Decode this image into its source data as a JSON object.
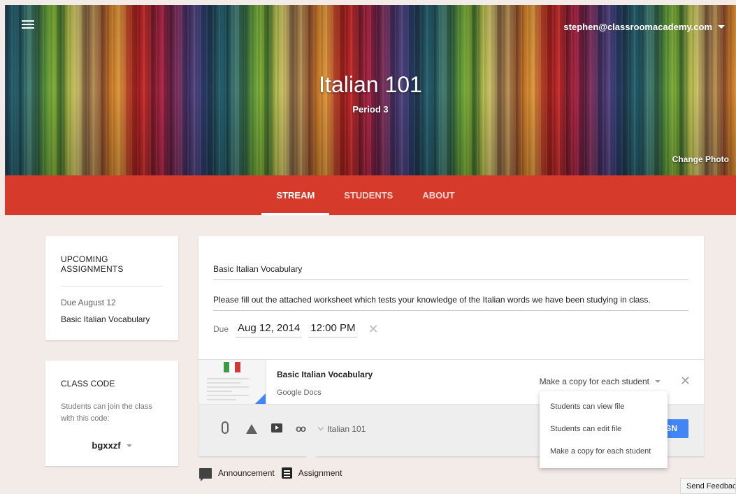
{
  "header": {
    "account_email": "stephen@classroomacademy.com",
    "class_title": "Italian 101",
    "class_period": "Period 3",
    "change_photo_label": "Change Photo"
  },
  "tabs": [
    {
      "label": "STREAM",
      "active": true
    },
    {
      "label": "STUDENTS",
      "active": false
    },
    {
      "label": "ABOUT",
      "active": false
    }
  ],
  "upcoming": {
    "heading": "UPCOMING ASSIGNMENTS",
    "due_label": "Due August 12",
    "item_label": "Basic Italian Vocabulary"
  },
  "class_code": {
    "heading": "CLASS CODE",
    "description": "Students can join the class with this code:",
    "code": "bgxxzf"
  },
  "composer": {
    "title_value": "Basic Italian Vocabulary",
    "description_value": "Please fill out the attached worksheet which tests your knowledge of the Italian words we have been studying in class.",
    "due_label": "Due",
    "due_date": "Aug 12, 2014",
    "due_time": "12:00 PM",
    "attachment": {
      "title": "Basic Italian Vocabulary",
      "source": "Google Docs",
      "sharing_mode": "Make a copy for each student"
    },
    "class_selector": "Italian 101",
    "assign_button": "ASSIGN"
  },
  "sharing_menu": {
    "options": [
      "Students can view file",
      "Students can edit file",
      "Make a copy for each student"
    ]
  },
  "post_types": {
    "announcement": "Announcement",
    "assignment": "Assignment"
  },
  "feedback_label": "Send Feedback",
  "colors": {
    "tab_bar": "#d53a2b",
    "page_bg": "#f3ebe8",
    "accent_blue": "#4285f4"
  },
  "icons": {
    "menu": "hamburger-menu-icon",
    "attach": "paperclip-icon",
    "drive": "google-drive-icon",
    "youtube": "youtube-icon",
    "link": "link-icon"
  }
}
